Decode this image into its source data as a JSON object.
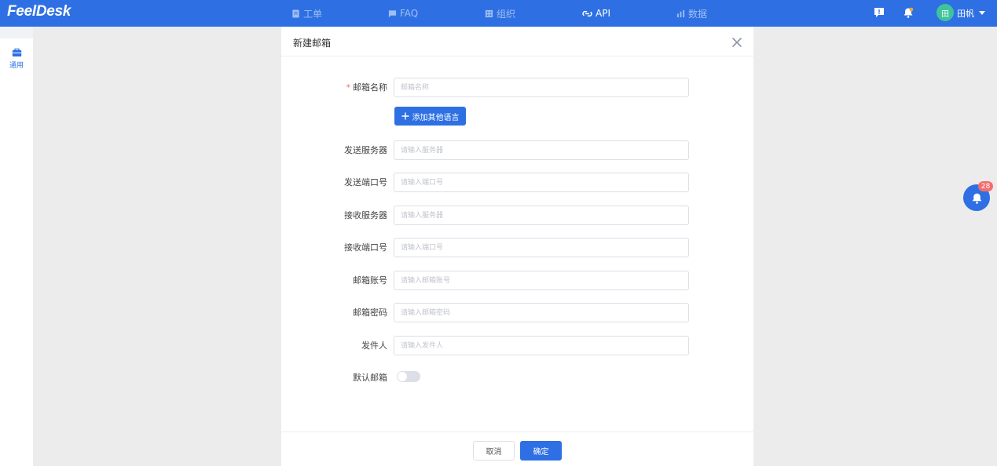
{
  "app": {
    "logo": "FeelDesk"
  },
  "nav": [
    {
      "label": "工单",
      "icon": "document-icon"
    },
    {
      "label": "FAQ",
      "icon": "chat-icon"
    },
    {
      "label": "组织",
      "icon": "building-icon"
    },
    {
      "label": "API",
      "icon": "link-icon"
    },
    {
      "label": "数据",
      "icon": "bar-chart-icon"
    }
  ],
  "user": {
    "avatar_text": "田",
    "name": "田帆"
  },
  "sidebar": {
    "items": [
      {
        "label": "通用",
        "icon": "toolbox-icon"
      }
    ]
  },
  "modal": {
    "title": "新建邮箱",
    "fields": [
      {
        "label": "邮箱名称",
        "placeholder": "邮箱名称",
        "required": true
      },
      {
        "label": "发送服务器",
        "placeholder": "请输入服务器"
      },
      {
        "label": "发送端口号",
        "placeholder": "请输入端口号"
      },
      {
        "label": "接收服务器",
        "placeholder": "请输入服务器"
      },
      {
        "label": "接收端口号",
        "placeholder": "请输入端口号"
      },
      {
        "label": "邮箱账号",
        "placeholder": "请输入邮箱账号"
      },
      {
        "label": "邮箱密码",
        "placeholder": "请输入邮箱密码"
      },
      {
        "label": "发件人",
        "placeholder": "请输入发件人"
      }
    ],
    "add_language_label": "添加其他语言",
    "default_label": "默认邮箱",
    "default_value": false,
    "cancel_label": "取消",
    "confirm_label": "确定"
  },
  "notifications": {
    "count": "28"
  },
  "colors": {
    "primary": "#2e70e3",
    "required": "#f56c6c",
    "avatar": "#3fc49a"
  }
}
